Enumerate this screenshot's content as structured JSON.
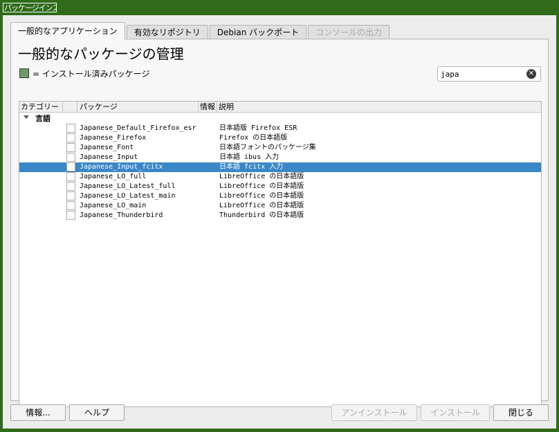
{
  "window": {
    "title": "パッケージインストーラー"
  },
  "tabs": [
    {
      "label": "一般的なアプリケーション"
    },
    {
      "label": "有効なリポジトリ"
    },
    {
      "label": "Debian バックポート"
    },
    {
      "label": "コンソールの出力"
    }
  ],
  "page": {
    "title": "一般的なパッケージの管理",
    "legend": "= インストール済みパッケージ"
  },
  "search": {
    "value": "japa",
    "clear_icon": "clear-circle-icon"
  },
  "tree": {
    "columns": [
      "カテゴリー",
      "",
      "パッケージ",
      "情報",
      "説明"
    ],
    "group": "言語",
    "rows": [
      {
        "package": "Japanese_Default_Firefox_esr",
        "description": "日本語版 Firefox ESR"
      },
      {
        "package": "Japanese_Firefox",
        "description": "Firefox の日本語版"
      },
      {
        "package": "Japanese_Font",
        "description": "日本語フォントのパッケージ集"
      },
      {
        "package": "Japanese_Input",
        "description": "日本語 ibus 入力"
      },
      {
        "package": "Japanese_Input_fcitx",
        "description": "日本語 fcitx 入力"
      },
      {
        "package": "Japanese_LO_full",
        "description": "LibreOffice の日本語版"
      },
      {
        "package": "Japanese_LO_Latest_full",
        "description": "LibreOffice の日本語版"
      },
      {
        "package": "Japanese_LO_Latest_main",
        "description": "LibreOffice の日本語版"
      },
      {
        "package": "Japanese_LO_main",
        "description": "LibreOffice の日本語版"
      },
      {
        "package": "Japanese_Thunderbird",
        "description": "Thunderbird の日本語版"
      }
    ],
    "selected_index": 4
  },
  "buttons": {
    "info": "情報...",
    "help": "ヘルプ",
    "uninstall": "アンインストール",
    "install": "インストール",
    "close": "閉じる"
  },
  "colors": {
    "titlebar": "#2f6b1a",
    "selection": "#3a87c8",
    "installed_swatch": "#6e9a6a"
  }
}
